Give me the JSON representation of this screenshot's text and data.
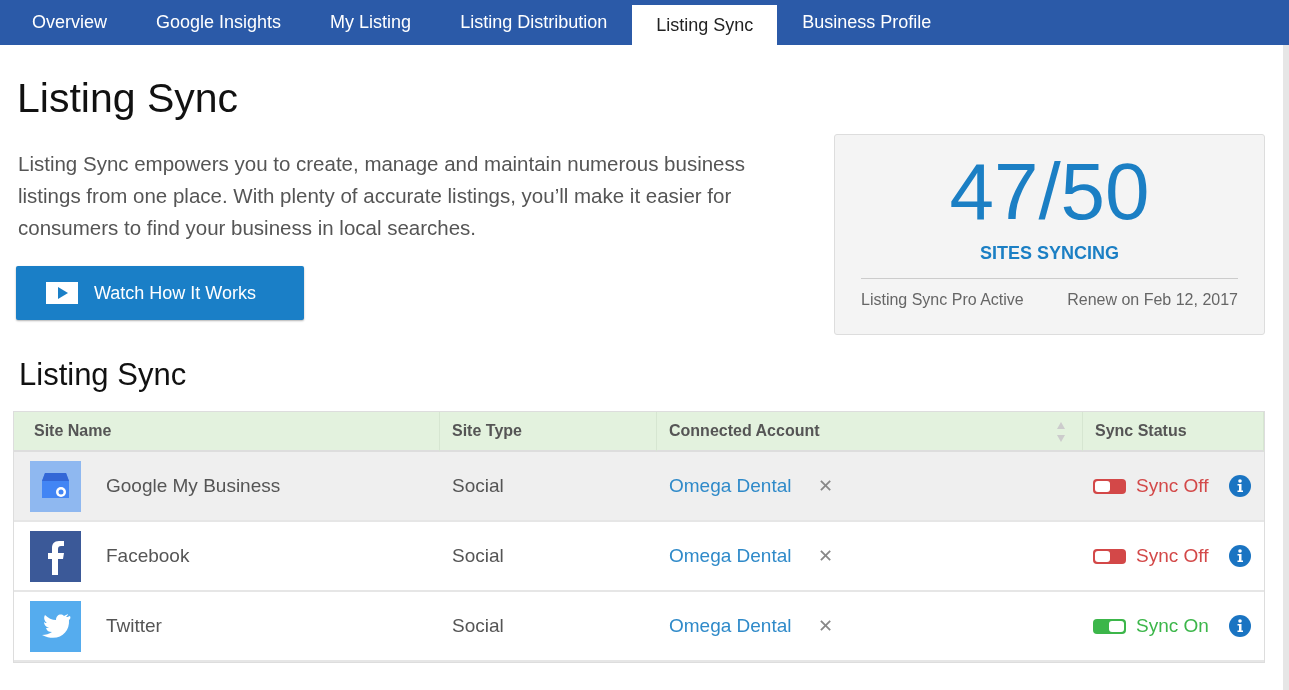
{
  "tabs": [
    {
      "label": "Overview",
      "selected": false
    },
    {
      "label": "Google Insights",
      "selected": false
    },
    {
      "label": "My Listing",
      "selected": false
    },
    {
      "label": "Listing Distribution",
      "selected": false
    },
    {
      "label": "Listing Sync",
      "selected": true
    },
    {
      "label": "Business Profile",
      "selected": false
    }
  ],
  "page_title": "Listing Sync",
  "intro": "Listing Sync empowers you to create, manage and maintain numerous business listings from one place. With plenty of accurate listings, you’ll make it easier for consumers to find your business in local searches.",
  "watch_button": "Watch How It Works",
  "summary": {
    "count": "47/50",
    "caption": "SITES SYNCING",
    "plan": "Listing Sync Pro Active",
    "renewal": "Renew on Feb 12, 2017"
  },
  "section_title": "Listing Sync",
  "table": {
    "columns": [
      {
        "label": "Site Name",
        "sortable": false
      },
      {
        "label": "Site Type",
        "sortable": false
      },
      {
        "label": "Connected Account",
        "sortable": true
      },
      {
        "label": "Sync Status",
        "sortable": false
      }
    ],
    "rows": [
      {
        "kind": "google",
        "site": "Google My Business",
        "type": "Social",
        "account": "Omega Dental",
        "remove": "✕",
        "on": false,
        "status": "Sync Off",
        "highlighted": true
      },
      {
        "kind": "facebook",
        "site": "Facebook",
        "type": "Social",
        "account": "Omega Dental",
        "remove": "✕",
        "on": false,
        "status": "Sync Off",
        "highlighted": false
      },
      {
        "kind": "twitter",
        "site": "Twitter",
        "type": "Social",
        "account": "Omega Dental",
        "remove": "✕",
        "on": true,
        "status": "Sync On",
        "highlighted": false
      }
    ]
  }
}
